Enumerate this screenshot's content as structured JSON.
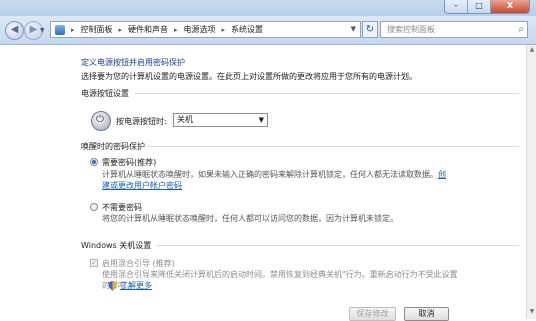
{
  "window": {
    "minimize": "–",
    "maximize": "□",
    "close": "X"
  },
  "nav": {
    "back": "◀",
    "forward": "▶",
    "breadcrumbs": [
      "控制面板",
      "硬件和声音",
      "电源选项",
      "系统设置"
    ],
    "refresh": "↻",
    "search_placeholder": "搜索控制面板"
  },
  "page": {
    "title": "定义电源按钮并启用密码保护",
    "intro": "选择要为您的计算机设置的电源设置。在此页上对设置所做的更改将应用于您所有的电源计划。",
    "power_section": "电源按钮设置",
    "power_label": "按电源按钮时:",
    "power_value": "关机",
    "wake_section": "唤醒时的密码保护",
    "opt1_label": "需要密码(推荐)",
    "opt1_desc1": "计算机从睡眠状态唤醒时，如果未输入正确的密码来解除计算机锁定，任何人都无法读取数据。",
    "opt1_link_inline": "创",
    "opt1_link": "建或更改用户帐户密码",
    "opt2_label": "不需要密码",
    "opt2_desc": "将您的计算机从睡眠状态唤醒时，任何人都可以访问您的数据，因为计算机未锁定。",
    "shutdown_section": "Windows 关机设置",
    "hybrid_label": "启用混合引导 (推荐)",
    "hybrid_desc1": "使用混合引导来降低关闭计算机后的启动时间。禁用恢复到经典关机\"行为。重新启动行为不受此设置",
    "hybrid_desc2": "的影响。",
    "hybrid_link": "了解更多",
    "save_button": "保存修改",
    "cancel_button": "取消"
  },
  "colors": {
    "accent": "#1c3e8e",
    "link": "#1a5fb4"
  }
}
